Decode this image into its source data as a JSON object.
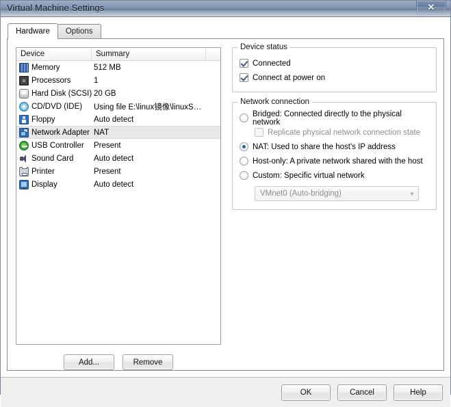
{
  "window": {
    "title": "Virtual Machine Settings",
    "close_label": "✕",
    "close_icon": "close-icon"
  },
  "tabs": [
    {
      "label": "Hardware",
      "active": true
    },
    {
      "label": "Options",
      "active": false
    }
  ],
  "device_list": {
    "columns": [
      "Device",
      "Summary",
      ""
    ],
    "rows": [
      {
        "icon": "memory-icon",
        "name": "Memory",
        "summary": "512 MB",
        "selected": false
      },
      {
        "icon": "cpu-icon",
        "name": "Processors",
        "summary": "1",
        "selected": false
      },
      {
        "icon": "hard-disk-icon",
        "name": "Hard Disk (SCSI)",
        "summary": "20 GB",
        "selected": false
      },
      {
        "icon": "cd-dvd-icon",
        "name": "CD/DVD (IDE)",
        "summary": "Using file E:\\linux镜像\\linuxS…",
        "selected": false
      },
      {
        "icon": "floppy-icon",
        "name": "Floppy",
        "summary": "Auto detect",
        "selected": false
      },
      {
        "icon": "network-adapter-icon",
        "name": "Network Adapter",
        "summary": "NAT",
        "selected": true
      },
      {
        "icon": "usb-icon",
        "name": "USB Controller",
        "summary": "Present",
        "selected": false
      },
      {
        "icon": "sound-card-icon",
        "name": "Sound Card",
        "summary": "Auto detect",
        "selected": false
      },
      {
        "icon": "printer-icon",
        "name": "Printer",
        "summary": "Present",
        "selected": false
      },
      {
        "icon": "display-icon",
        "name": "Display",
        "summary": "Auto detect",
        "selected": false
      }
    ],
    "add_label": "Add...",
    "remove_label": "Remove"
  },
  "device_status": {
    "group_label": "Device status",
    "connected": {
      "label": "Connected",
      "checked": true
    },
    "connect_at_power_on": {
      "label": "Connect at power on",
      "checked": true
    }
  },
  "network_connection": {
    "group_label": "Network connection",
    "options": [
      {
        "label": "Bridged: Connected directly to the physical network",
        "selected": false
      },
      {
        "label": "NAT: Used to share the host's IP address",
        "selected": true
      },
      {
        "label": "Host-only: A private network shared with the host",
        "selected": false
      },
      {
        "label": "Custom: Specific virtual network",
        "selected": false
      }
    ],
    "replicate": {
      "label": "Replicate physical network connection state",
      "checked": false,
      "disabled": true
    },
    "vmnet_select": {
      "value": "VMnet0 (Auto-bridging)",
      "disabled": true,
      "arrow": "▼"
    }
  },
  "footer": {
    "ok_label": "OK",
    "cancel_label": "Cancel",
    "help_label": "Help"
  }
}
